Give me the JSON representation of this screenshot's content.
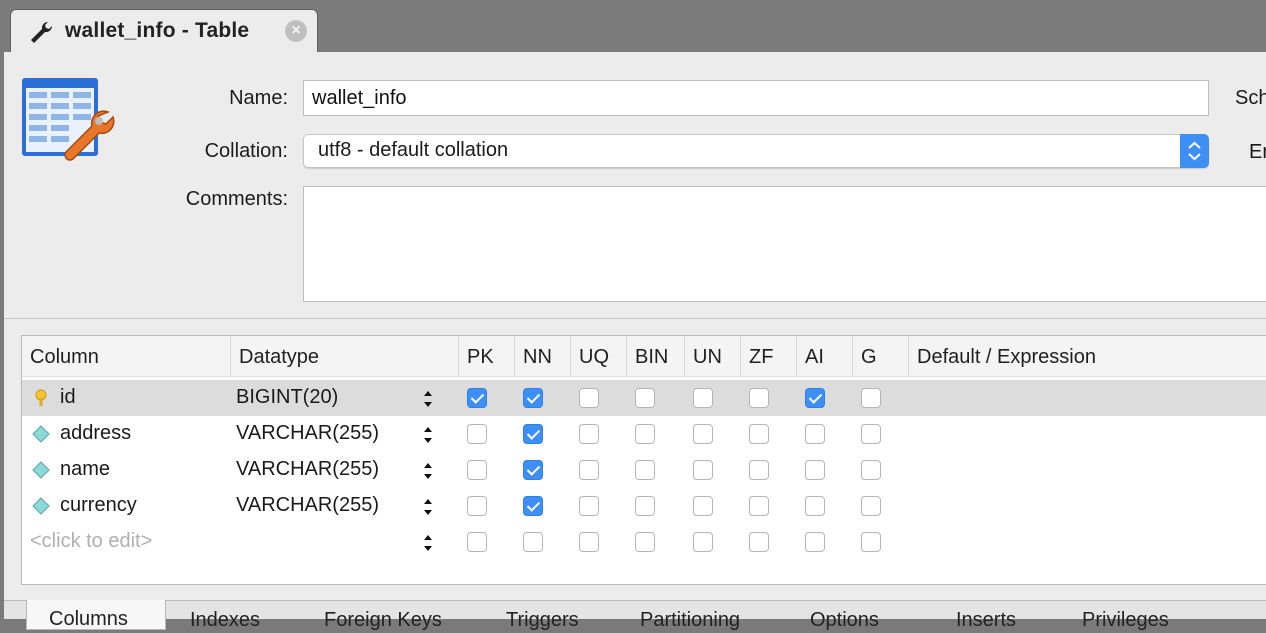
{
  "tab": {
    "title": "wallet_info - Table"
  },
  "form": {
    "name_label": "Name:",
    "name_value": "wallet_info",
    "collation_label": "Collation:",
    "collation_value": "utf8 - default collation",
    "comments_label": "Comments:",
    "schema_label_partial": "Sch",
    "engine_label_partial": "En"
  },
  "grid": {
    "headers": [
      "Column",
      "Datatype",
      "PK",
      "NN",
      "UQ",
      "BIN",
      "UN",
      "ZF",
      "AI",
      "G",
      "Default / Expression"
    ],
    "rows": [
      {
        "name": "id",
        "type": "BIGINT(20)",
        "icon": "key-icon",
        "flags": [
          true,
          true,
          false,
          false,
          false,
          false,
          true,
          false
        ]
      },
      {
        "name": "address",
        "type": "VARCHAR(255)",
        "icon": "diamond-icon",
        "flags": [
          false,
          true,
          false,
          false,
          false,
          false,
          false,
          false
        ]
      },
      {
        "name": "name",
        "type": "VARCHAR(255)",
        "icon": "diamond-icon",
        "flags": [
          false,
          true,
          false,
          false,
          false,
          false,
          false,
          false
        ]
      },
      {
        "name": "currency",
        "type": "VARCHAR(255)",
        "icon": "diamond-icon",
        "flags": [
          false,
          true,
          false,
          false,
          false,
          false,
          false,
          false
        ]
      },
      {
        "name": "<click to edit>",
        "type": "",
        "icon": "",
        "flags": [
          false,
          false,
          false,
          false,
          false,
          false,
          false,
          false
        ]
      }
    ]
  },
  "bottom_tabs": [
    "Columns",
    "Indexes",
    "Foreign Keys",
    "Triggers",
    "Partitioning",
    "Options",
    "Inserts",
    "Privileges"
  ],
  "colors": {
    "accent": "#3d8ff5",
    "selected_row": "#dcdcdc",
    "panel": "#ececec"
  }
}
